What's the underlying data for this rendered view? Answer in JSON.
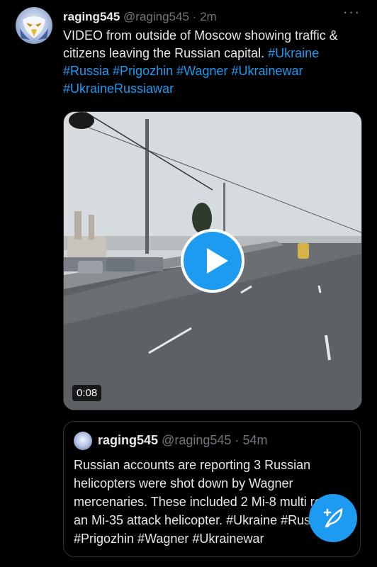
{
  "tweet": {
    "author_name": "raging545",
    "handle": "@raging545",
    "separator": "·",
    "time": "2m",
    "text_plain": "VIDEO from outside of Moscow showing traffic & citizens leaving the Russian capital.",
    "hashtags": [
      "#Ukraine",
      "#Russia",
      "#Prigozhin",
      "#Wagner",
      "#Ukrainewar",
      "#UkraineRussiawar"
    ],
    "more_label": "···"
  },
  "video": {
    "duration": "0:08",
    "play_icon": "play-icon"
  },
  "quote": {
    "author_name": "raging545",
    "handle": "@raging545",
    "separator": "·",
    "time": "54m",
    "text": "Russian accounts are reporting 3 Russian helicopters were shot down by Wagner mercenaries. These included 2 Mi-8 multi role & an Mi-35 attack helicopter. #Ukraine #Russia #Prigozhin #Wagner #Ukrainewar"
  },
  "fab": {
    "icon": "compose-feather-icon"
  },
  "colors": {
    "accent": "#1d9bf0",
    "muted": "#71767b",
    "text": "#e7e9ea",
    "border": "#2f3336",
    "background": "#000000"
  }
}
